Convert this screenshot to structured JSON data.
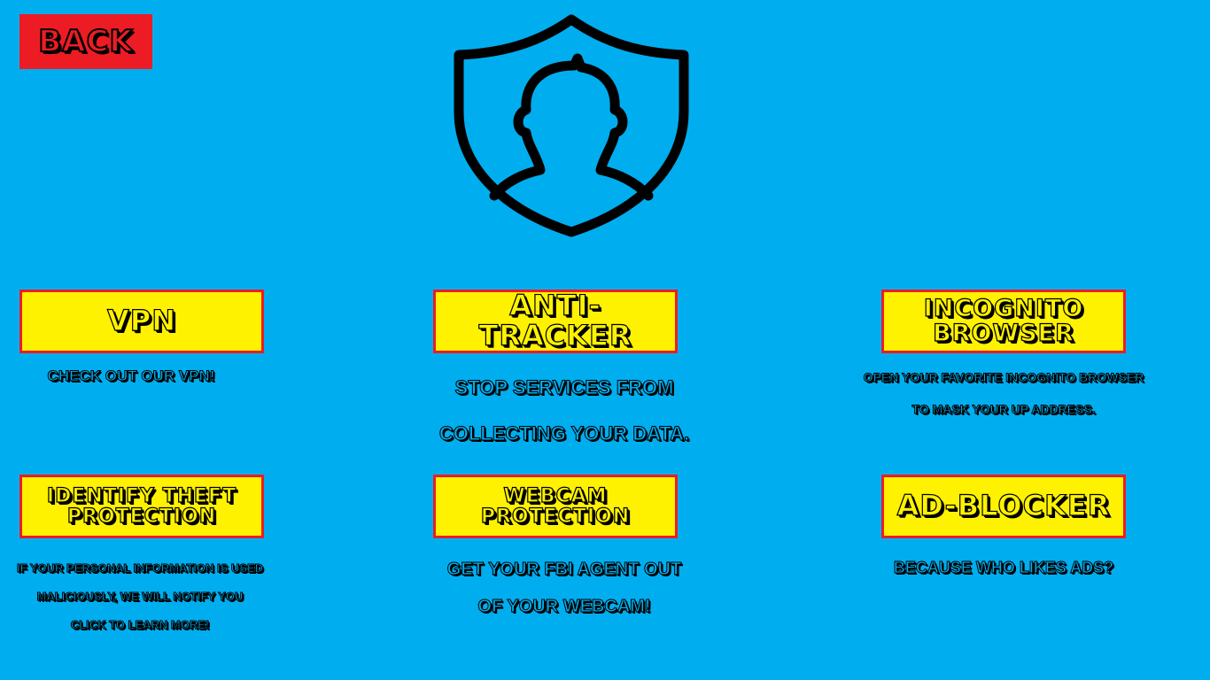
{
  "back_button": {
    "label": "BACK"
  },
  "header_graphic": {
    "icon": "shield-user-icon"
  },
  "features": [
    {
      "title": "VPN",
      "description": [
        "CHECK OUT OUR VPN!"
      ]
    },
    {
      "title": "ANTI-TRACKER",
      "description": [
        "STOP SERVICES FROM",
        "COLLECTING YOUR DATA."
      ]
    },
    {
      "title": "INCOGNITO BROWSER",
      "description": [
        "OPEN YOUR FAVORITE INCOGNITO BROWSER",
        "TO MASK YOUR UP ADDRESS."
      ]
    },
    {
      "title": "IDENTIFY THEFT PROTECTION",
      "description": [
        "IF YOUR PERSONAL INFORMATION IS USED",
        "MALICIOUSLY, WE WILL NOTIFY YOU",
        "CLICK TO LEARN MORE!"
      ]
    },
    {
      "title": "WEBCAM PROTECTION",
      "description": [
        "GET YOUR FBI AGENT OUT",
        "OF YOUR WEBCAM!"
      ]
    },
    {
      "title": "AD-BLOCKER",
      "description": [
        "BECAUSE WHO LIKES ADS?"
      ]
    }
  ],
  "colors": {
    "background": "#00aeef",
    "card": "#fff200",
    "accent": "#ed1c24",
    "outline": "#000000"
  }
}
